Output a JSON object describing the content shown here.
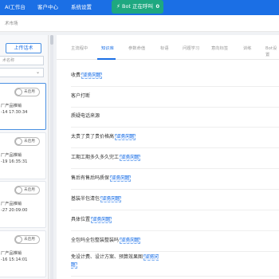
{
  "topnav": {
    "items": [
      "AI工作台",
      "客户中心",
      "系统设置"
    ],
    "bot_icon": "⚡",
    "bot_label": "Bot 正在呼叫",
    "bot_count": "0"
  },
  "breadcrumb": "术市场",
  "left": {
    "upload_label": "上传话术",
    "search_placeholder": "术名称",
    "cards": [
      {
        "toggle": "未启用",
        "text": "厂产品推销",
        "time": "-14 17:30:34"
      },
      {
        "toggle": "未启用",
        "text": "厂产品推销",
        "time": "-19 16:35:31"
      },
      {
        "toggle": "未启用",
        "text": "厂产品推销",
        "time": "-27 20:09:00"
      },
      {
        "toggle": "未启用",
        "text": "厂产品推销",
        "time": "-16 15:14:01"
      }
    ]
  },
  "tabs": [
    {
      "label": "主流程中"
    },
    {
      "label": "知识库"
    },
    {
      "label": "参数命值"
    },
    {
      "label": "标语"
    },
    {
      "label": "问题学习"
    },
    {
      "label": "意向标签"
    },
    {
      "label": "训练"
    },
    {
      "label": "Bot设置"
    }
  ],
  "qa_rows": [
    {
      "question": "收费",
      "tag": "业务问题"
    },
    {
      "question": "客户打断",
      "tag": ""
    },
    {
      "question": "质疑电话来源",
      "tag": ""
    },
    {
      "question": "太贵了贵了贵价格高",
      "tag": "业务问题"
    },
    {
      "question": "工期工期多久多久完工",
      "tag": "业务问题"
    },
    {
      "question": "售后有售后吗质保",
      "tag": "业务问题"
    },
    {
      "question": "基装半包清包",
      "tag": "业务问题"
    },
    {
      "question": "具体位置",
      "tag": "业务问题"
    },
    {
      "question": "全包吗全包整装整装吗",
      "tag": "业务问题"
    },
    {
      "question": "免设计费、设计方案、预算效果图",
      "tag": "业务问题"
    }
  ]
}
